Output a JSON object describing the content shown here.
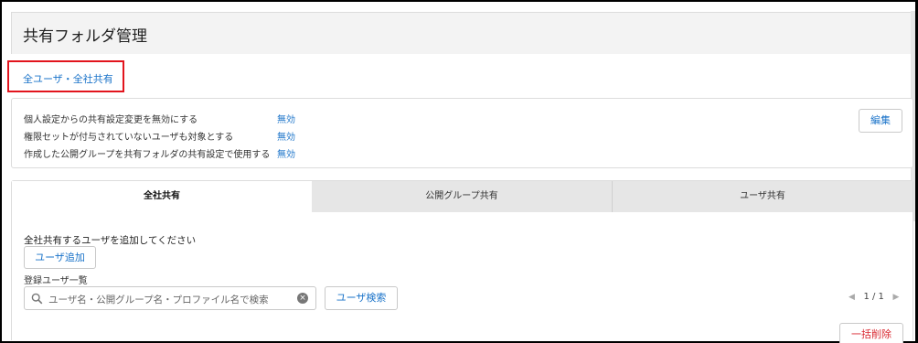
{
  "page": {
    "title": "共有フォルダ管理"
  },
  "link": {
    "label": "全ユーザ・全社共有"
  },
  "settings": {
    "rows": [
      {
        "label": "個人設定からの共有設定変更を無効にする",
        "value": "無効"
      },
      {
        "label": "権限セットが付与されていないユーザも対象とする",
        "value": "無効"
      },
      {
        "label": "作成した公開グループを共有フォルダの共有設定で使用する",
        "value": "無効"
      }
    ],
    "edit_label": "編集"
  },
  "tabs": [
    {
      "label": "全社共有",
      "active": true
    },
    {
      "label": "公開グループ共有",
      "active": false
    },
    {
      "label": "ユーザ共有",
      "active": false
    }
  ],
  "main": {
    "instruction": "全社共有するユーザを追加してください",
    "add_label": "ユーザ追加",
    "list_label": "登録ユーザ一覧",
    "search_placeholder": "ユーザ名・公開グループ名・プロファイル名で検索",
    "search_button": "ユーザ検索",
    "pager": "1 / 1",
    "bulk_delete": "一括削除"
  },
  "icons": {
    "search": "search-icon",
    "clear": "clear-icon",
    "prev": "chevron-left-icon",
    "next": "chevron-right-icon"
  },
  "colors": {
    "link": "#1a73c9",
    "highlight": "#e2141d",
    "danger": "#d9272f"
  }
}
